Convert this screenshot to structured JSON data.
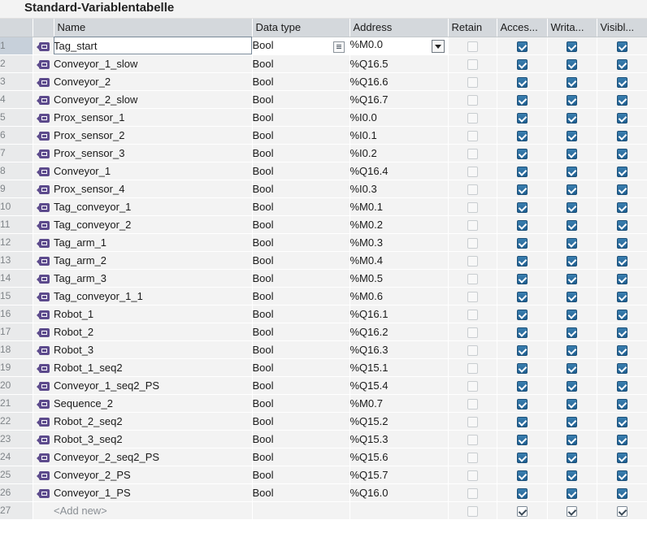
{
  "title": "Standard-Variablentabelle",
  "columns": {
    "name": "Name",
    "data_type": "Data type",
    "address": "Address",
    "retain": "Retain",
    "accessible": "Acces...",
    "writable": "Writa...",
    "visible": "Visibl..."
  },
  "icons": {
    "row_icon": "tag-icon",
    "data_type_picker": "list-picker-icon",
    "address_dropdown": "chevron-down-icon"
  },
  "rows": [
    {
      "n": "1",
      "name": "Tag_start",
      "type": "Bool",
      "address": "%M0.0"
    },
    {
      "n": "2",
      "name": "Conveyor_1_slow",
      "type": "Bool",
      "address": "%Q16.5"
    },
    {
      "n": "3",
      "name": "Conveyor_2",
      "type": "Bool",
      "address": "%Q16.6"
    },
    {
      "n": "4",
      "name": "Conveyor_2_slow",
      "type": "Bool",
      "address": "%Q16.7"
    },
    {
      "n": "5",
      "name": "Prox_sensor_1",
      "type": "Bool",
      "address": "%I0.0"
    },
    {
      "n": "6",
      "name": "Prox_sensor_2",
      "type": "Bool",
      "address": "%I0.1"
    },
    {
      "n": "7",
      "name": "Prox_sensor_3",
      "type": "Bool",
      "address": "%I0.2"
    },
    {
      "n": "8",
      "name": "Conveyor_1",
      "type": "Bool",
      "address": "%Q16.4"
    },
    {
      "n": "9",
      "name": "Prox_sensor_4",
      "type": "Bool",
      "address": "%I0.3"
    },
    {
      "n": "10",
      "name": "Tag_conveyor_1",
      "type": "Bool",
      "address": "%M0.1"
    },
    {
      "n": "11",
      "name": "Tag_conveyor_2",
      "type": "Bool",
      "address": "%M0.2"
    },
    {
      "n": "12",
      "name": "Tag_arm_1",
      "type": "Bool",
      "address": "%M0.3"
    },
    {
      "n": "13",
      "name": "Tag_arm_2",
      "type": "Bool",
      "address": "%M0.4"
    },
    {
      "n": "14",
      "name": "Tag_arm_3",
      "type": "Bool",
      "address": "%M0.5"
    },
    {
      "n": "15",
      "name": "Tag_conveyor_1_1",
      "type": "Bool",
      "address": "%M0.6"
    },
    {
      "n": "16",
      "name": "Robot_1",
      "type": "Bool",
      "address": "%Q16.1"
    },
    {
      "n": "17",
      "name": "Robot_2",
      "type": "Bool",
      "address": "%Q16.2"
    },
    {
      "n": "18",
      "name": "Robot_3",
      "type": "Bool",
      "address": "%Q16.3"
    },
    {
      "n": "19",
      "name": "Robot_1_seq2",
      "type": "Bool",
      "address": "%Q15.1"
    },
    {
      "n": "20",
      "name": "Conveyor_1_seq2_PS",
      "type": "Bool",
      "address": "%Q15.4"
    },
    {
      "n": "21",
      "name": "Sequence_2",
      "type": "Bool",
      "address": "%M0.7"
    },
    {
      "n": "22",
      "name": "Robot_2_seq2",
      "type": "Bool",
      "address": "%Q15.2"
    },
    {
      "n": "23",
      "name": "Robot_3_seq2",
      "type": "Bool",
      "address": "%Q15.3"
    },
    {
      "n": "24",
      "name": "Conveyor_2_seq2_PS",
      "type": "Bool",
      "address": "%Q15.6"
    },
    {
      "n": "25",
      "name": "Conveyor_2_PS",
      "type": "Bool",
      "address": "%Q15.7"
    },
    {
      "n": "26",
      "name": "Conveyor_1_PS",
      "type": "Bool",
      "address": "%Q16.0"
    }
  ],
  "add_new": {
    "n": "27",
    "name": "<Add new>"
  },
  "colors": {
    "checkbox_on": "#2a6c9e",
    "header_bg": "#d4d8dc",
    "row_bg": "#f3f3f3",
    "tag_icon": "#5c4a8c"
  }
}
